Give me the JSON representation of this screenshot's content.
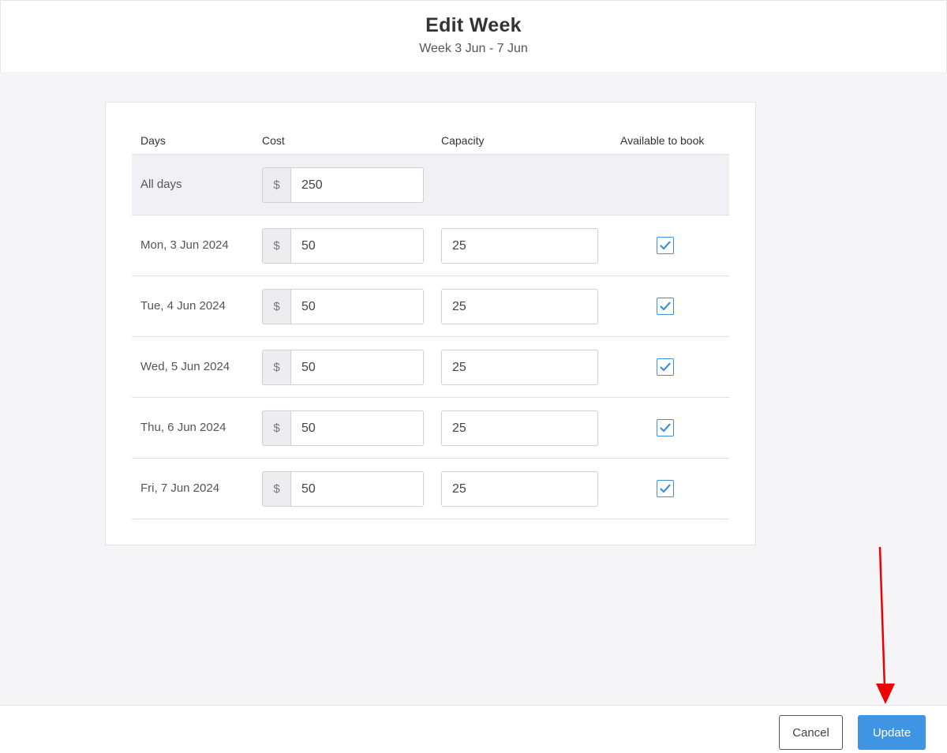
{
  "header": {
    "title": "Edit Week",
    "subtitle": "Week 3 Jun - 7 Jun"
  },
  "table": {
    "columns": {
      "days": "Days",
      "cost": "Cost",
      "capacity": "Capacity",
      "available": "Available to book"
    },
    "currency_symbol": "$",
    "all_days": {
      "label": "All days",
      "cost": "250"
    },
    "rows": [
      {
        "day": "Mon, 3 Jun 2024",
        "cost": "50",
        "capacity": "25",
        "available": true
      },
      {
        "day": "Tue, 4 Jun 2024",
        "cost": "50",
        "capacity": "25",
        "available": true
      },
      {
        "day": "Wed, 5 Jun 2024",
        "cost": "50",
        "capacity": "25",
        "available": true
      },
      {
        "day": "Thu, 6 Jun 2024",
        "cost": "50",
        "capacity": "25",
        "available": true
      },
      {
        "day": "Fri, 7 Jun 2024",
        "cost": "50",
        "capacity": "25",
        "available": true
      }
    ]
  },
  "footer": {
    "cancel_label": "Cancel",
    "update_label": "Update"
  },
  "colors": {
    "accent": "#3f94e4",
    "checkbox": "#3d8fd6",
    "annotation_arrow": "#ee0000"
  }
}
